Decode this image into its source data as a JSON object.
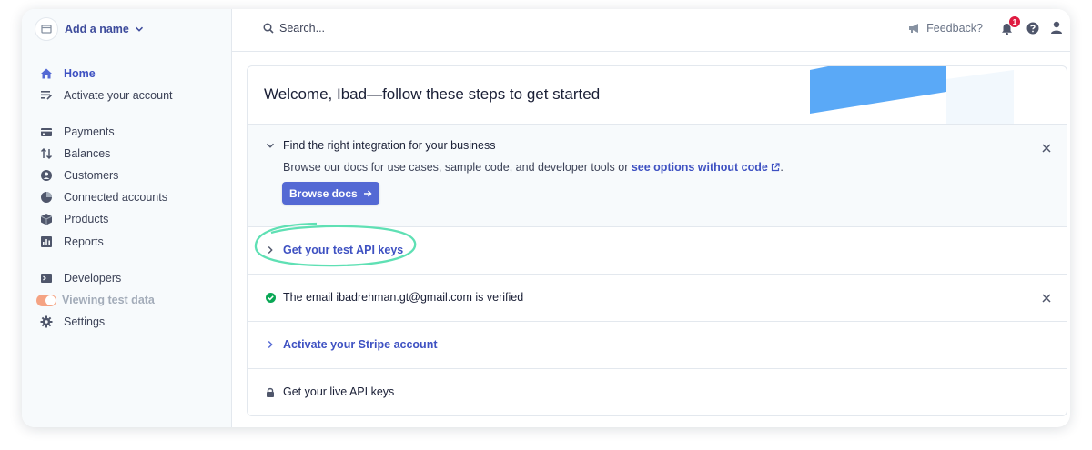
{
  "account": {
    "name": "Add a name"
  },
  "sidebar": {
    "items": [
      {
        "label": "Home"
      },
      {
        "label": "Activate your account"
      },
      {
        "label": "Payments"
      },
      {
        "label": "Balances"
      },
      {
        "label": "Customers"
      },
      {
        "label": "Connected accounts"
      },
      {
        "label": "Products"
      },
      {
        "label": "Reports"
      },
      {
        "label": "Developers"
      },
      {
        "label": "Viewing test data"
      },
      {
        "label": "Settings"
      }
    ]
  },
  "topbar": {
    "search_placeholder": "Search...",
    "feedback_label": "Feedback?",
    "notification_count": "1"
  },
  "card": {
    "title": "Welcome, Ibad—follow these steps to get started",
    "integration": {
      "heading": "Find the right integration for your business",
      "description": "Browse our docs for use cases, sample code, and developer tools or ",
      "link": "see options without code",
      "period": ".",
      "button": "Browse docs"
    },
    "steps": [
      {
        "label": "Get your test API keys"
      },
      {
        "label": "The email ibadrehman.gt@gmail.com is verified"
      },
      {
        "label": "Activate your Stripe account"
      },
      {
        "label": "Get your live API keys"
      }
    ]
  },
  "colors": {
    "accent": "#5469d4",
    "link": "#3e51c2",
    "success": "#09a755",
    "highlight": "#5fe0b4",
    "badge": "#df1b41"
  }
}
